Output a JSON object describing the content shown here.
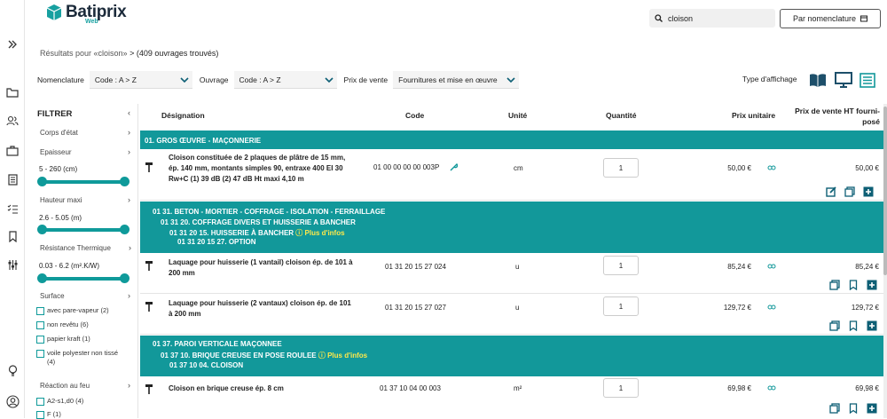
{
  "app": {
    "name": "Batiprix",
    "sub": "Web"
  },
  "search": {
    "value": "cloison"
  },
  "nomenclature_button": "Par nomenclature",
  "results": {
    "prefix": "Résultats pour «cloison»",
    "suffix": " > (409 ouvrages trouvés)"
  },
  "filters": {
    "nomenclature_label": "Nomenclature",
    "nomenclature_value": "Code : A > Z",
    "ouvrage_label": "Ouvrage",
    "ouvrage_value": "Code : A > Z",
    "prix_label": "Prix de vente",
    "prix_value": "Fournitures et mise en œuvre"
  },
  "display_type_label": "Type d'affichage",
  "sidebar": {
    "title": "FILTRER",
    "corps": "Corps d'état",
    "epaisseur": "Epaisseur",
    "epaisseur_range": "5 - 260  (cm)",
    "hauteur": "Hauteur maxi",
    "hauteur_range": "2.6 - 5.05  (m)",
    "resistance": "Résistance Thermique",
    "resistance_range": "0.03 - 6.2  (m².K/W)",
    "surface": "Surface",
    "surface_options": [
      "avec pare-vapeur (2)",
      "non revêtu (6)",
      "papier kraft (1)",
      "voile polyester non tissé (4)"
    ],
    "reaction": "Réaction au feu",
    "reaction_options": [
      "A2-s1,d0 (4)",
      "F (1)"
    ]
  },
  "table": {
    "headers": {
      "designation": "Désignation",
      "code": "Code",
      "unite": "Unité",
      "quantite": "Quantité",
      "prix": "Prix unitaire",
      "pv1": "Prix de vente HT fourni-",
      "pv2": "posé"
    },
    "band1": "01. GROS ŒUVRE - MAÇONNERIE",
    "row1": {
      "d1": "Cloison constituée de 2 plaques de plâtre de 15 mm,",
      "d2": "ép. 140 mm, montants simples 90, entraxe 400 EI 30",
      "d3": "Rw+C (1) 39 dB (2) 47 dB Ht maxi 4,10 m",
      "code": "01 00 00 00 00 003P",
      "unit": "cm",
      "qty": "1",
      "prix": "50,00 €",
      "pv": "50,00 €"
    },
    "band2": {
      "l1": "01 31. BETON - MORTIER - COFFRAGE - ISOLATION - FERRAILLAGE",
      "l2": "01 31 20. COFFRAGE DIVERS ET HUISSERIE A BANCHER",
      "l3": "01 31 20 15. HUISSERIE À BANCHER",
      "more": "Plus d'infos",
      "l4": "01 31 20 15 27. OPTION"
    },
    "row2": {
      "d1": "Laquage pour huisserie (1 vantail) cloison ép. de 101 à",
      "d2": "200 mm",
      "code": "01 31 20 15 27 024",
      "unit": "u",
      "qty": "1",
      "prix": "85,24 €",
      "pv": "85,24 €"
    },
    "row3": {
      "d1": "Laquage pour huisserie (2 vantaux) cloison ép. de 101",
      "d2": "à 200 mm",
      "code": "01 31 20 15 27 027",
      "unit": "u",
      "qty": "1",
      "prix": "129,72 €",
      "pv": "129,72 €"
    },
    "band3": {
      "l1": "01 37. PAROI VERTICALE MAÇONNEE",
      "l2": "01 37 10. BRIQUE CREUSE EN POSE ROULEE",
      "more": "Plus d'infos",
      "l3": "01 37 10 04. CLOISON"
    },
    "row4": {
      "d1": "Cloison en brique creuse ép. 8 cm",
      "code": "01 37 10 04 00 003",
      "unit": "m²",
      "qty": "1",
      "prix": "69,98 €",
      "pv": "69,98 €"
    }
  },
  "colors": {
    "accent": "#12989a"
  }
}
